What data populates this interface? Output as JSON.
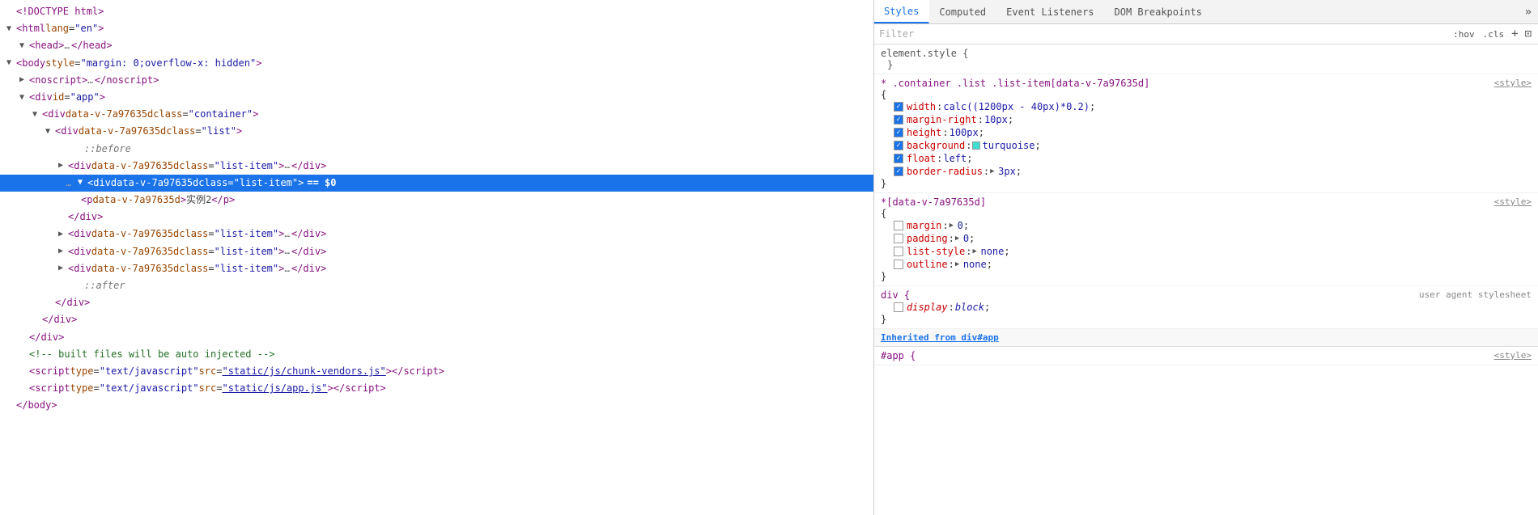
{
  "dom": {
    "lines": [
      {
        "id": 1,
        "indent": 0,
        "triangle": "none",
        "dots": false,
        "content_type": "doctype",
        "text": "<!DOCTYPE html>"
      },
      {
        "id": 2,
        "indent": 0,
        "triangle": "open",
        "dots": false,
        "content_type": "tag_open",
        "tag": "html",
        "attrs": [
          {
            "name": "lang",
            "value": "\"en\""
          }
        ]
      },
      {
        "id": 3,
        "indent": 1,
        "triangle": "open",
        "dots": true,
        "content_type": "tag_collapse",
        "tag": "head",
        "close_tag": "head"
      },
      {
        "id": 4,
        "indent": 0,
        "triangle": "open",
        "dots": false,
        "content_type": "tag_open",
        "tag": "body",
        "attrs": [
          {
            "name": "style",
            "value": "\"margin: 0;overflow-x: hidden\""
          }
        ]
      },
      {
        "id": 5,
        "indent": 1,
        "triangle": "closed",
        "dots": true,
        "content_type": "tag_collapse",
        "tag": "noscript",
        "close_tag": "noscript"
      },
      {
        "id": 6,
        "indent": 1,
        "triangle": "open",
        "dots": false,
        "content_type": "tag_open",
        "tag": "div",
        "attrs": [
          {
            "name": "id",
            "value": "\"app\""
          }
        ]
      },
      {
        "id": 7,
        "indent": 2,
        "triangle": "open",
        "dots": false,
        "content_type": "tag_open",
        "tag": "div",
        "attrs": [
          {
            "name": "data-v-7a97635d",
            "value": null
          },
          {
            "name": "class",
            "value": "\"container\""
          }
        ]
      },
      {
        "id": 8,
        "indent": 3,
        "triangle": "open",
        "dots": false,
        "content_type": "tag_open",
        "tag": "div",
        "attrs": [
          {
            "name": "data-v-7a97635d",
            "value": null
          },
          {
            "name": "class",
            "value": "\"list\""
          }
        ]
      },
      {
        "id": 9,
        "indent": 4,
        "triangle": "none",
        "dots": false,
        "content_type": "pseudo",
        "text": "::before"
      },
      {
        "id": 10,
        "indent": 4,
        "triangle": "closed",
        "dots": true,
        "content_type": "tag_collapse",
        "tag": "div",
        "attrs": [
          {
            "name": "data-v-7a97635d",
            "value": null
          },
          {
            "name": "class",
            "value": "\"list-item\""
          }
        ]
      },
      {
        "id": 11,
        "indent": 4,
        "triangle": "open",
        "dots": false,
        "content_type": "tag_open_selected",
        "tag": "div",
        "attrs": [
          {
            "name": "data-v-7a97635d",
            "value": null
          },
          {
            "name": "class",
            "value": "\"list-item\""
          }
        ],
        "dollar": "== $0"
      },
      {
        "id": 12,
        "indent": 5,
        "triangle": "none",
        "dots": false,
        "content_type": "tag_inline",
        "tag": "p",
        "attrs": [
          {
            "name": "data-v-7a97635d",
            "value": null
          }
        ],
        "inner_text": "实例2"
      },
      {
        "id": 13,
        "indent": 4,
        "triangle": "none",
        "dots": false,
        "content_type": "close_tag",
        "tag": "div"
      },
      {
        "id": 14,
        "indent": 4,
        "triangle": "closed",
        "dots": true,
        "content_type": "tag_collapse",
        "tag": "div",
        "attrs": [
          {
            "name": "data-v-7a97635d",
            "value": null
          },
          {
            "name": "class",
            "value": "\"list-item\""
          }
        ]
      },
      {
        "id": 15,
        "indent": 4,
        "triangle": "closed",
        "dots": true,
        "content_type": "tag_collapse",
        "tag": "div",
        "attrs": [
          {
            "name": "data-v-7a97635d",
            "value": null
          },
          {
            "name": "class",
            "value": "\"list-item\""
          }
        ]
      },
      {
        "id": 16,
        "indent": 4,
        "triangle": "closed",
        "dots": true,
        "content_type": "tag_collapse",
        "tag": "div",
        "attrs": [
          {
            "name": "data-v-7a97635d",
            "value": null
          },
          {
            "name": "class",
            "value": "\"list-item\""
          }
        ]
      },
      {
        "id": 17,
        "indent": 4,
        "triangle": "none",
        "dots": false,
        "content_type": "pseudo",
        "text": "::after"
      },
      {
        "id": 18,
        "indent": 3,
        "triangle": "none",
        "dots": false,
        "content_type": "close_tag",
        "tag": "div"
      },
      {
        "id": 19,
        "indent": 2,
        "triangle": "none",
        "dots": false,
        "content_type": "close_tag",
        "tag": "div"
      },
      {
        "id": 20,
        "indent": 1,
        "triangle": "none",
        "dots": false,
        "content_type": "close_tag",
        "tag": "div"
      },
      {
        "id": 21,
        "indent": 1,
        "triangle": "none",
        "dots": false,
        "content_type": "comment",
        "text": "<!-- built files will be auto injected -->"
      },
      {
        "id": 22,
        "indent": 1,
        "triangle": "none",
        "dots": false,
        "content_type": "tag_script",
        "tag": "script",
        "attrs": [
          {
            "name": "type",
            "value": "\"text/javascript\""
          },
          {
            "name": "src",
            "value": "\"static/js/chunk-vendors.js\""
          }
        ]
      },
      {
        "id": 23,
        "indent": 1,
        "triangle": "none",
        "dots": false,
        "content_type": "tag_script",
        "tag": "script",
        "attrs": [
          {
            "name": "type",
            "value": "\"text/javascript\""
          },
          {
            "name": "src",
            "value": "\"static/js/app.js\""
          }
        ]
      },
      {
        "id": 24,
        "indent": 0,
        "triangle": "none",
        "dots": false,
        "content_type": "close_tag",
        "tag": "body"
      }
    ]
  },
  "styles_panel": {
    "tabs": [
      "Styles",
      "Computed",
      "Event Listeners",
      "DOM Breakpoints"
    ],
    "active_tab": "Styles",
    "more_label": "»",
    "filter_placeholder": "Filter",
    "hov_label": ":hov",
    "cls_label": ".cls",
    "plus_label": "+",
    "expand_label": "⊡",
    "rules": [
      {
        "id": "element-style",
        "selector": "element.style {",
        "close": "}",
        "properties": []
      },
      {
        "id": "container-list-item",
        "selector": "* .container .list .list-item[data-v-7a97635d]",
        "source": "<style>",
        "open": "{",
        "close": "}",
        "properties": [
          {
            "checked": true,
            "name": "width",
            "value": "calc((1200px - 40px)*0.2);"
          },
          {
            "checked": true,
            "name": "margin-right",
            "value": "10px;"
          },
          {
            "checked": true,
            "name": "height",
            "value": "100px;"
          },
          {
            "checked": true,
            "name": "background",
            "value": "turquoise;",
            "has_swatch": true,
            "swatch_color": "turquoise"
          },
          {
            "checked": true,
            "name": "float",
            "value": "left;"
          },
          {
            "checked": true,
            "name": "border-radius",
            "value": "3px;",
            "has_triangle": true
          }
        ]
      },
      {
        "id": "data-v-attr",
        "selector": "*[data-v-7a97635d]",
        "source": "<style>",
        "open": "{",
        "close": "}",
        "properties": [
          {
            "checked": false,
            "name": "margin",
            "value": "0;",
            "has_triangle": true
          },
          {
            "checked": false,
            "name": "padding",
            "value": "0;",
            "has_triangle": true
          },
          {
            "checked": false,
            "name": "list-style",
            "value": "none;",
            "has_triangle": true
          },
          {
            "checked": false,
            "name": "outline",
            "value": "none;",
            "has_triangle": true
          }
        ]
      },
      {
        "id": "div-user-agent",
        "selector": "div {",
        "source": "user agent stylesheet",
        "close": "}",
        "properties": [
          {
            "checked": false,
            "name": "display",
            "value": "block;",
            "italic": true
          }
        ]
      }
    ],
    "inherited_label": "Inherited from",
    "inherited_element": "div#app",
    "inherited_source": "<style>"
  }
}
